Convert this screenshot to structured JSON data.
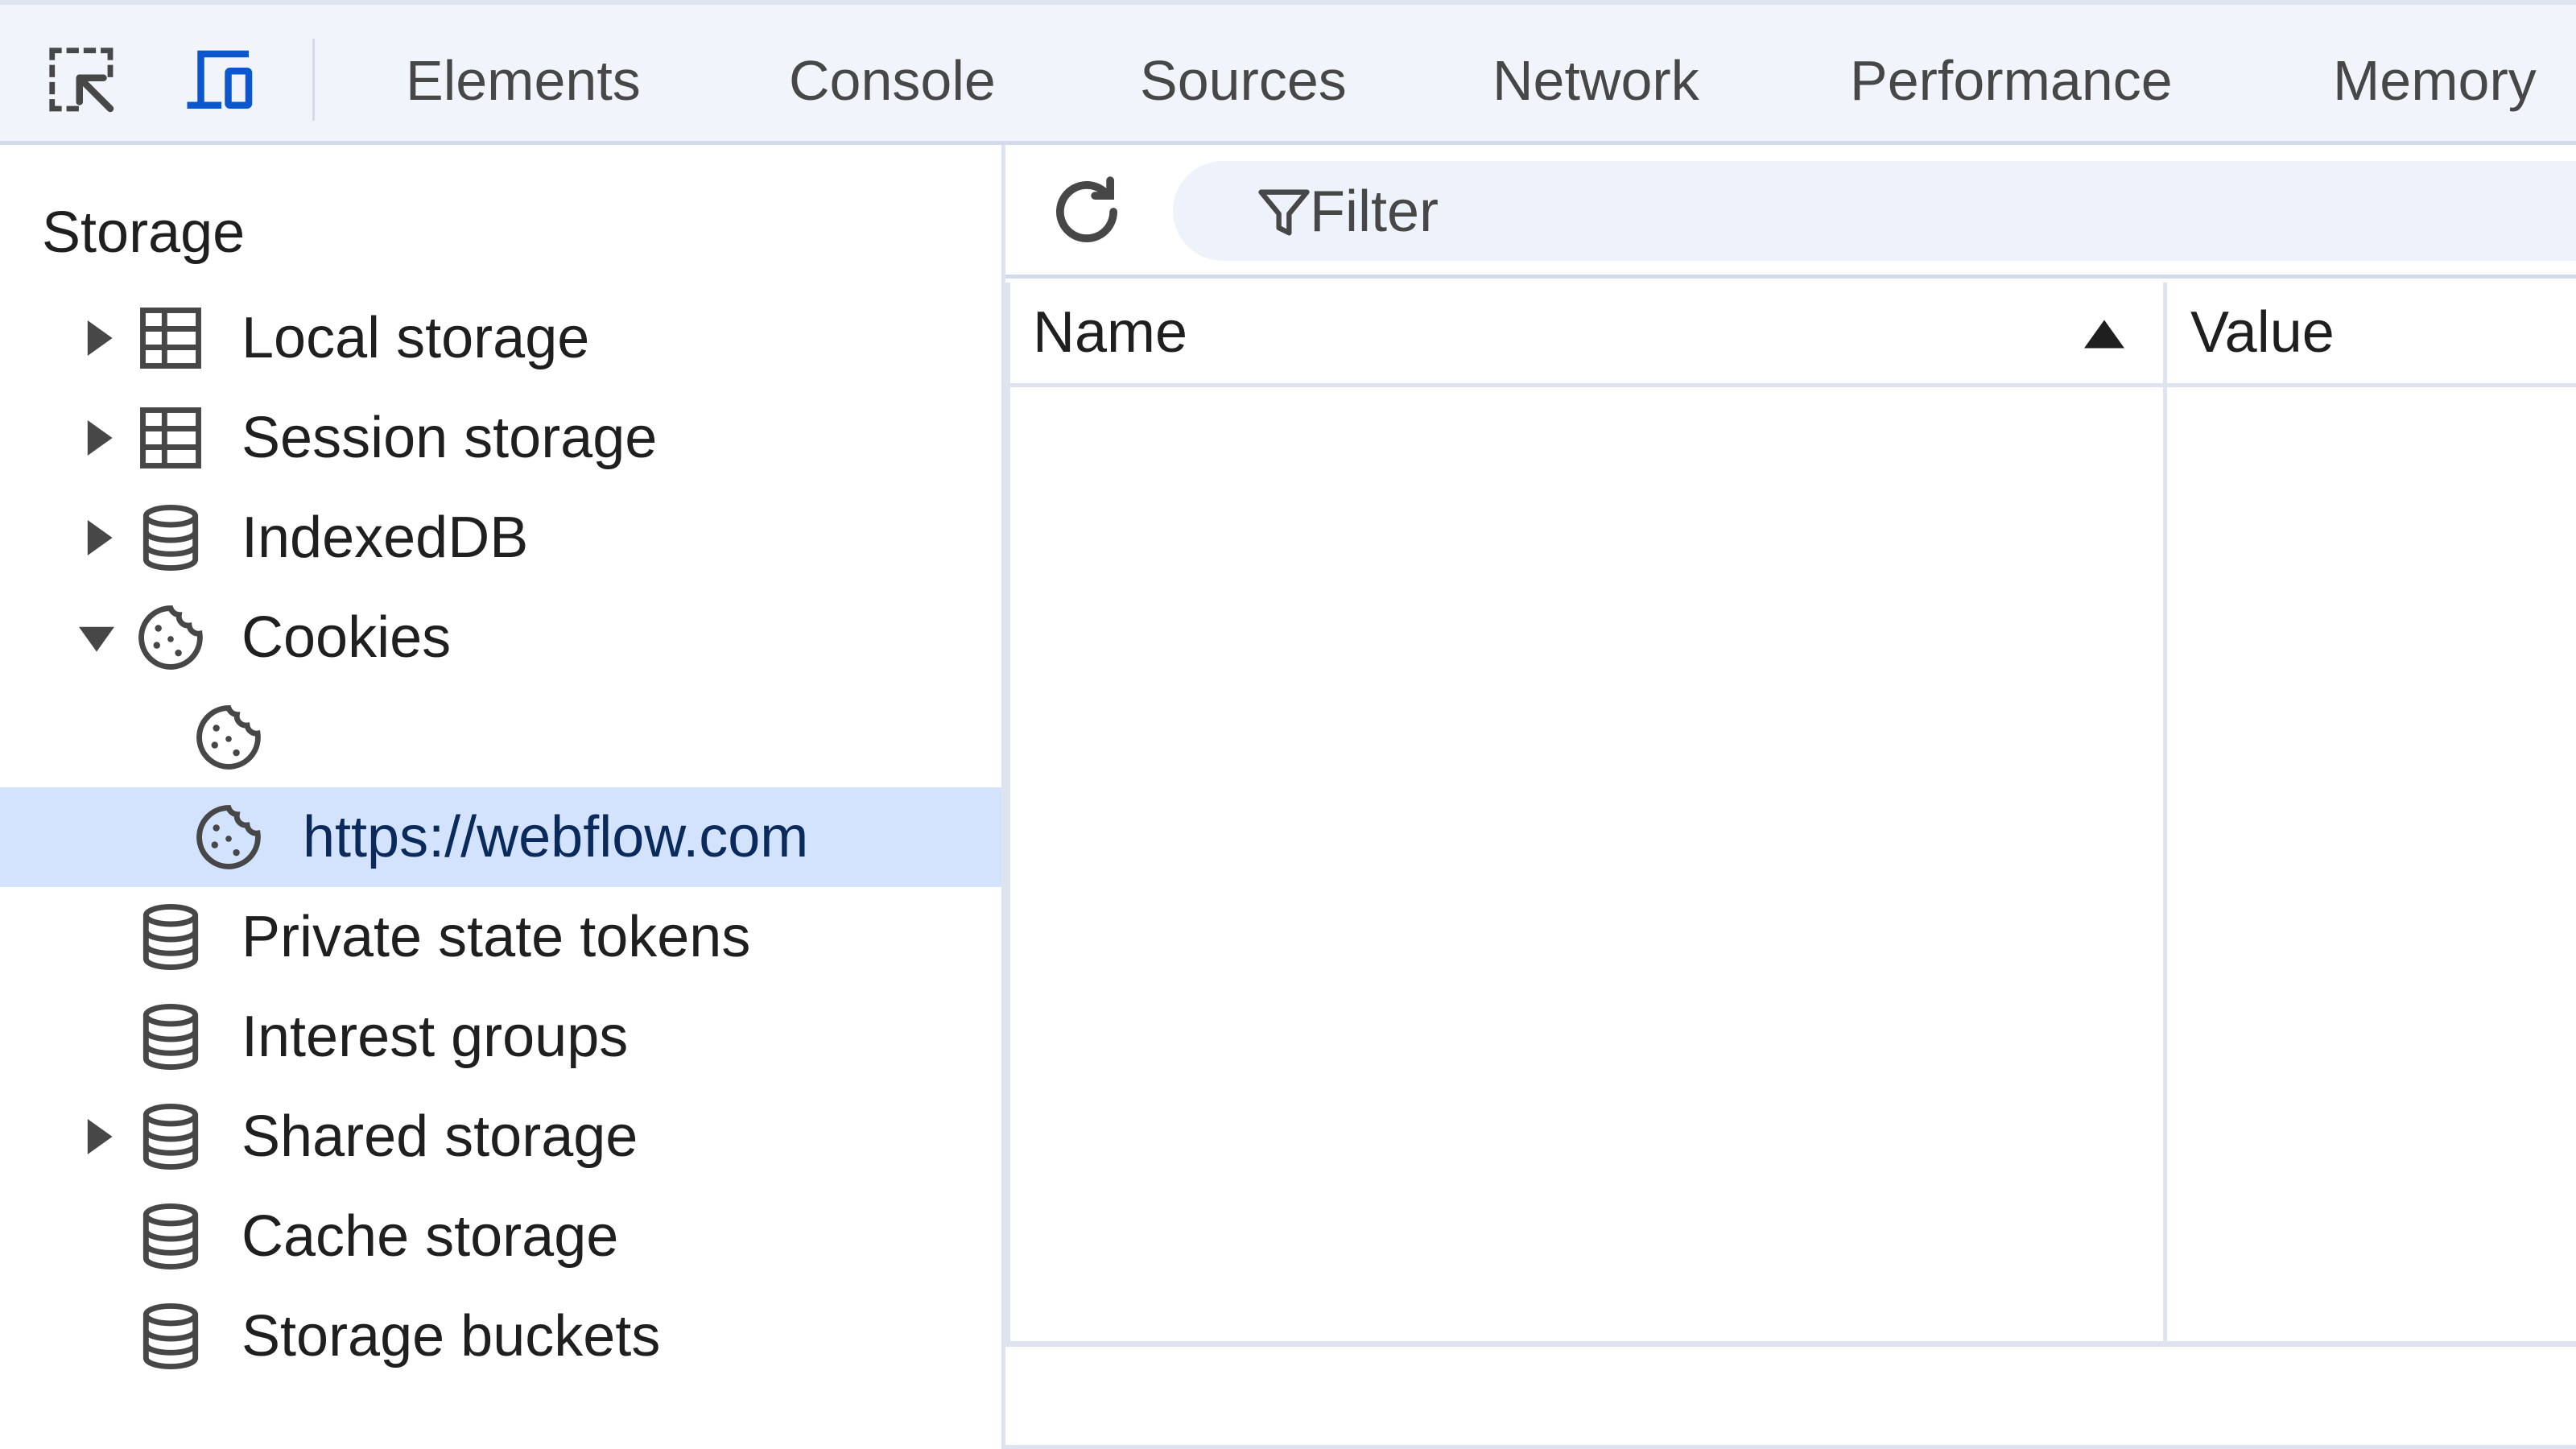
{
  "toolbar": {
    "inspect_icon": "inspect-element-icon",
    "device_icon": "device-toolbar-icon",
    "active_accent": "#0b57d0",
    "tabs": [
      {
        "label": "Elements"
      },
      {
        "label": "Console"
      },
      {
        "label": "Sources"
      },
      {
        "label": "Network"
      },
      {
        "label": "Performance"
      },
      {
        "label": "Memory"
      }
    ]
  },
  "sidebar": {
    "section_title": "Storage",
    "selected_bg": "#d3e3fd",
    "items": [
      {
        "label": "Local storage",
        "icon": "table-grid-icon",
        "expandable": true,
        "expanded": false
      },
      {
        "label": "Session storage",
        "icon": "table-grid-icon",
        "expandable": true,
        "expanded": false
      },
      {
        "label": "IndexedDB",
        "icon": "database-icon",
        "expandable": true,
        "expanded": false
      },
      {
        "label": "Cookies",
        "icon": "cookie-icon",
        "expandable": true,
        "expanded": true
      },
      {
        "label": "",
        "icon": "cookie-icon",
        "child": true
      },
      {
        "label": "https://webflow.com",
        "icon": "cookie-icon",
        "child": true,
        "selected": true
      },
      {
        "label": "Private state tokens",
        "icon": "database-icon"
      },
      {
        "label": "Interest groups",
        "icon": "database-icon"
      },
      {
        "label": "Shared storage",
        "icon": "database-icon",
        "expandable": true,
        "expanded": false
      },
      {
        "label": "Cache storage",
        "icon": "database-icon"
      },
      {
        "label": "Storage buckets",
        "icon": "database-icon"
      }
    ]
  },
  "main": {
    "refresh_icon": "refresh-icon",
    "filter": {
      "icon": "filter-icon",
      "placeholder": "Filter",
      "value": ""
    },
    "table": {
      "columns": [
        {
          "label": "Name",
          "sort": "ascending"
        },
        {
          "label": "Value"
        }
      ],
      "rows": []
    }
  }
}
